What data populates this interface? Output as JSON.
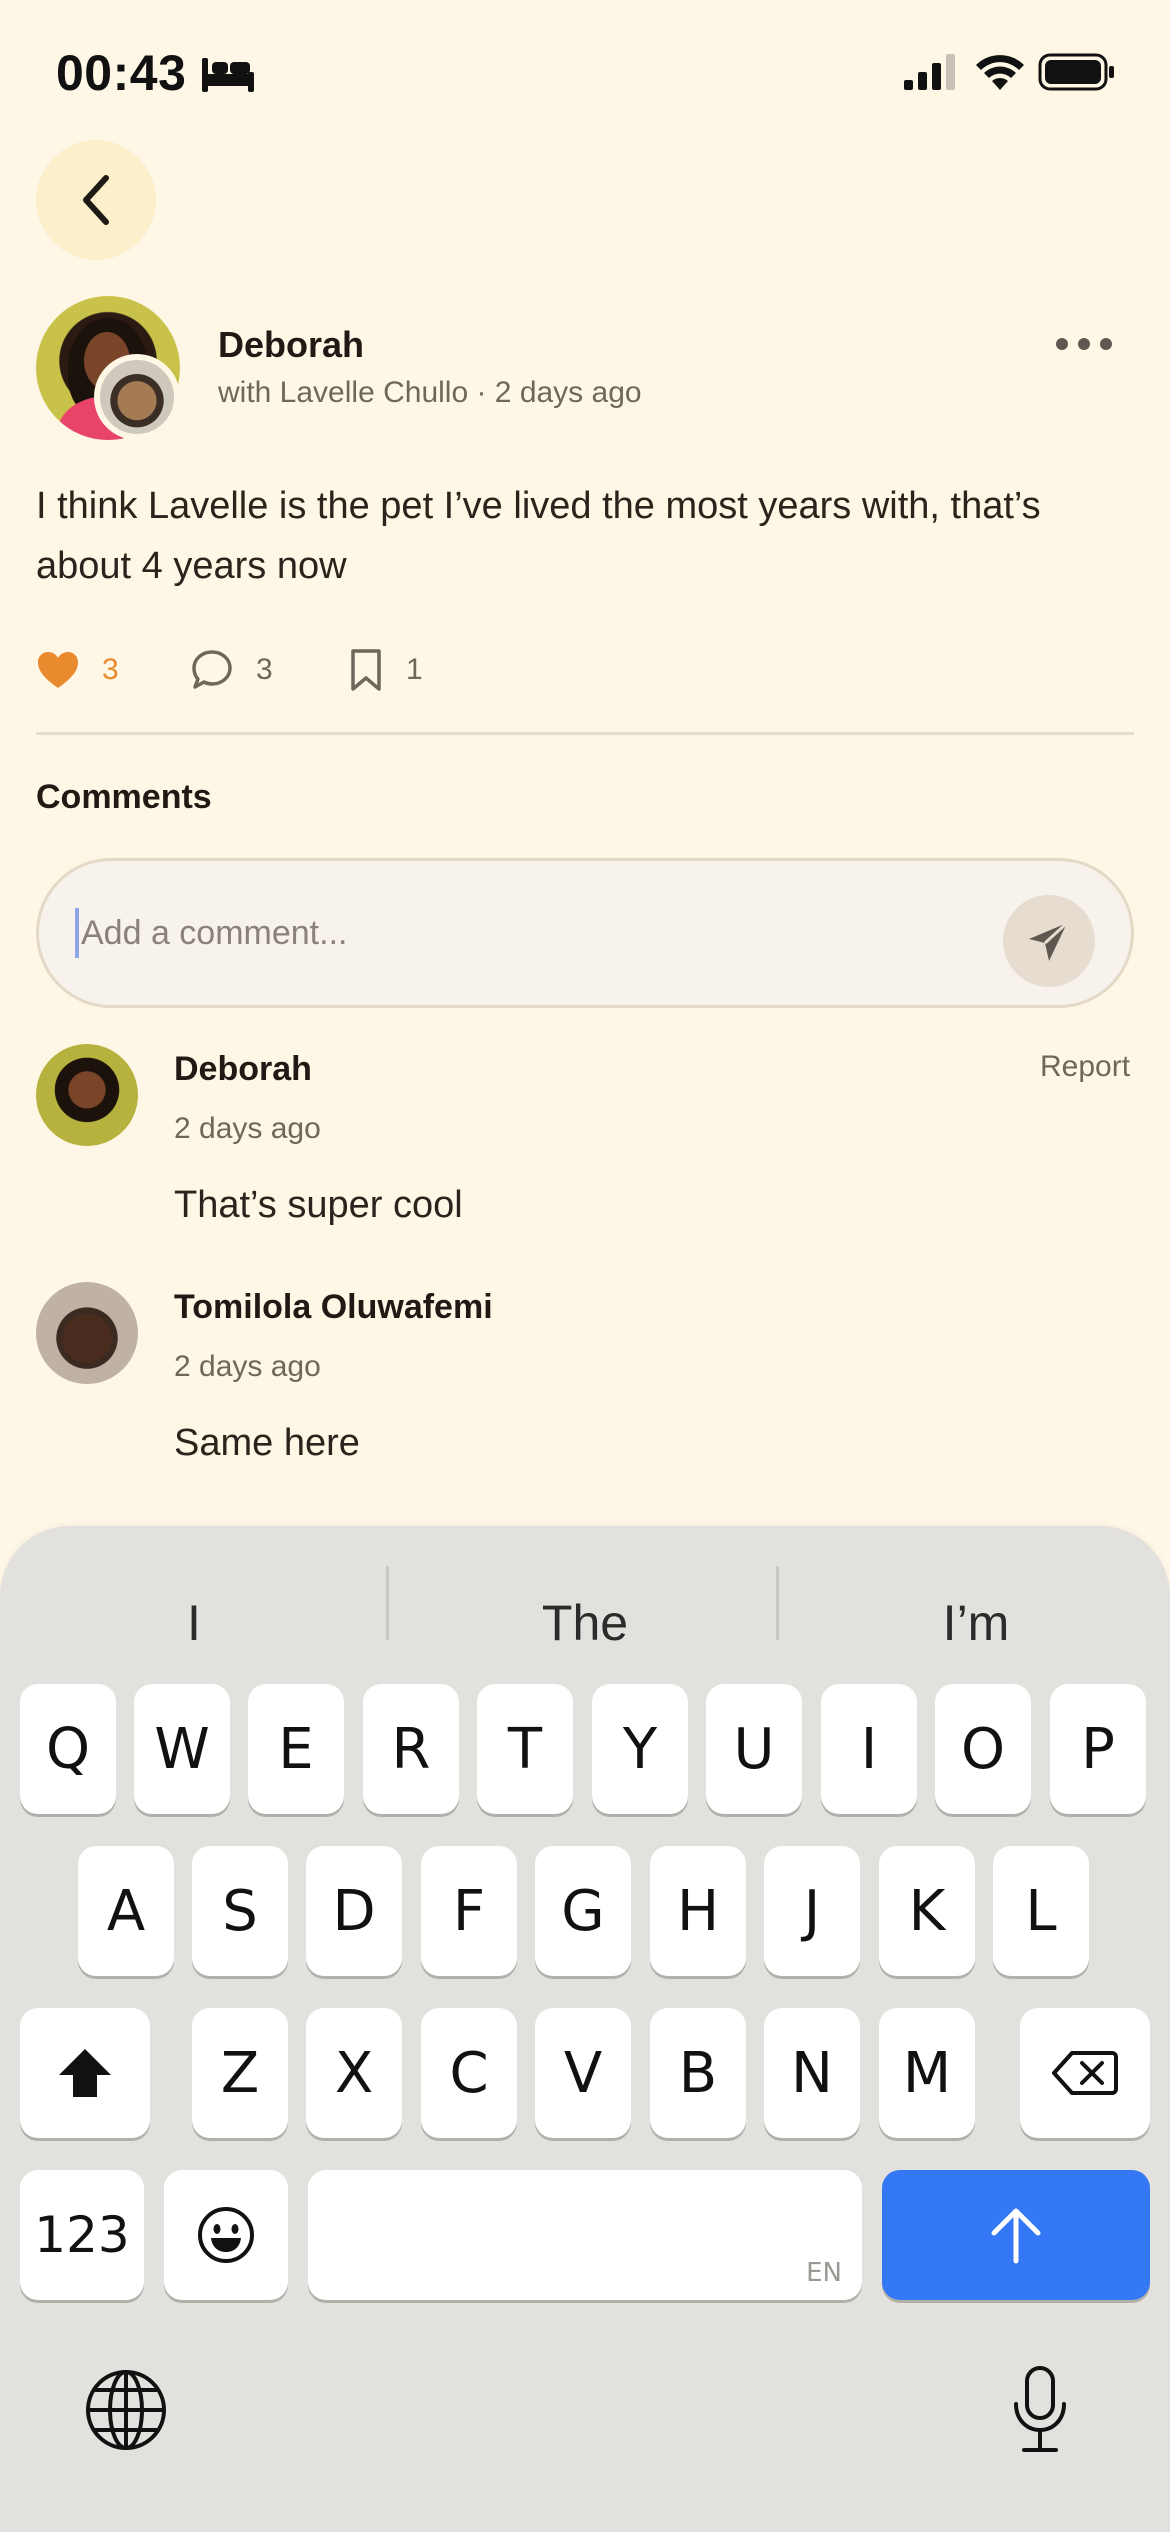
{
  "status_bar": {
    "time": "00:43"
  },
  "post": {
    "author": "Deborah",
    "meta": "with Lavelle Chullo · 2 days ago",
    "text": "I think Lavelle is the pet I’ve lived the most years with, that’s about 4 years now",
    "likes": "3",
    "comments": "3",
    "bookmarks": "1",
    "accent_color": "#E98A2E"
  },
  "comments_section": {
    "title": "Comments",
    "input_placeholder": "Add a comment...",
    "items": [
      {
        "name": "Deborah",
        "time": "2 days ago",
        "text": "That’s super cool",
        "action": "Report"
      },
      {
        "name": "Tomilola Oluwafemi",
        "time": "2 days ago",
        "text": "Same here"
      }
    ]
  },
  "keyboard": {
    "suggestions": [
      "I",
      "The",
      "I’m"
    ],
    "row1": [
      "Q",
      "W",
      "E",
      "R",
      "T",
      "Y",
      "U",
      "I",
      "O",
      "P"
    ],
    "row2": [
      "A",
      "S",
      "D",
      "F",
      "G",
      "H",
      "J",
      "K",
      "L"
    ],
    "row3": [
      "Z",
      "X",
      "C",
      "V",
      "B",
      "N",
      "M"
    ],
    "numbers_label": "123",
    "space_lang": "EN",
    "return_color": "#3478F6"
  }
}
